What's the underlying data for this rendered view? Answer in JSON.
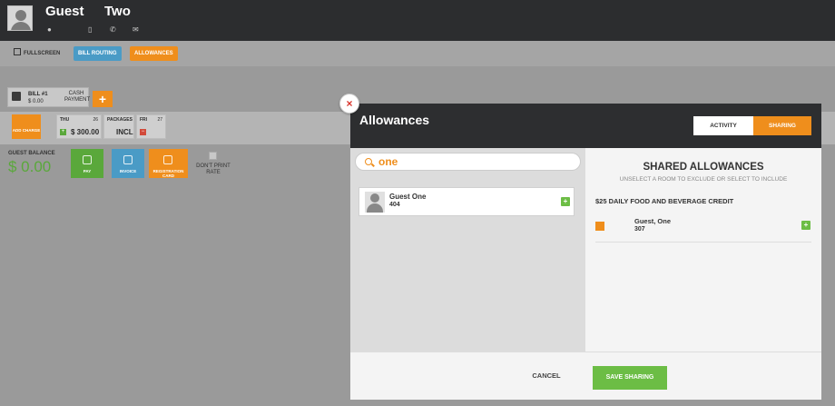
{
  "header": {
    "first_name": "Guest",
    "last_name": "Two",
    "icons": [
      "map-pin-icon",
      "mobile-phone-icon",
      "phone-icon",
      "email-icon"
    ]
  },
  "toolbar": {
    "fullscreen_label": "FULLSCREEN",
    "bill_routing_label": "BILL ROUTING",
    "allowances_label": "ALLOWANCES"
  },
  "bill": {
    "tab_title": "BILL #1",
    "tab_amount": "$ 0.00",
    "tab_type": "CASH PAYMENT",
    "add_bill_symbol": "+",
    "add_charge_label": "ADD CHARGE",
    "days": [
      {
        "label": "THU",
        "num": "26",
        "value": "$ 300.00",
        "sign": "+"
      },
      {
        "label": "PACKAGES",
        "num": "",
        "value": "INCL",
        "sign": ""
      },
      {
        "label": "FRI",
        "num": "27",
        "value": "",
        "sign": "−"
      }
    ]
  },
  "balance": {
    "label": "GUEST BALANCE",
    "value": "$ 0.00"
  },
  "actions": {
    "pay_label": "PAY",
    "invoice_label": "INVOICE",
    "registration_label": "REGISTRATION CARD",
    "dont_print_label": "DON'T PRINT RATE"
  },
  "modal": {
    "title": "Allowances",
    "tab_activity": "ACTIVITY",
    "tab_sharing": "SHARING",
    "close_symbol": "×",
    "search": {
      "value": "one",
      "placeholder": ""
    },
    "results": [
      {
        "name": "Guest One",
        "room": "404"
      }
    ],
    "shared": {
      "title": "SHARED ALLOWANCES",
      "subtitle": "UNSELECT A ROOM TO EXCLUDE OR SELECT TO INCLUDE",
      "allowance_name": "$25 DAILY FOOD AND BEVERAGE CREDIT",
      "rooms": [
        {
          "name": "Guest, One",
          "room": "307"
        }
      ]
    },
    "add_symbol": "+",
    "cancel_label": "CANCEL",
    "save_label": "SAVE SHARING"
  },
  "colors": {
    "accent_orange": "#ef8e1c",
    "accent_green": "#6cbd45",
    "accent_blue": "#4a9bc6",
    "header_dark": "#2d2e30",
    "close_red": "#d9342b"
  }
}
